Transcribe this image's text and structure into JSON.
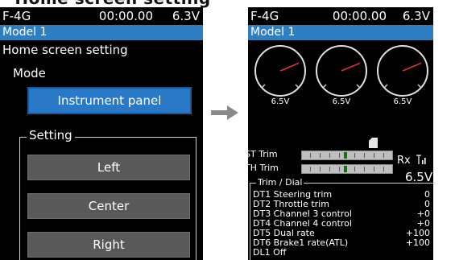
{
  "left_screen": {
    "status": {
      "name": "F-4G",
      "time": "00:00.00",
      "voltage": "6.3V"
    },
    "model": "Model 1",
    "heading": "Home screen setting",
    "mode_label": "Mode",
    "mode_value": "Instrument panel",
    "setting_label": "Setting",
    "buttons": [
      "Left",
      "Center",
      "Right"
    ]
  },
  "right_screen": {
    "status": {
      "name": "F-4G",
      "time": "00:00.00",
      "voltage": "6.3V"
    },
    "model": "Model 1",
    "gauges": [
      {
        "value": "6.5V",
        "needle_level": 0.75
      },
      {
        "value": "6.5V",
        "needle_level": 0.75
      },
      {
        "value": "6.5V",
        "needle_level": 0.75
      }
    ],
    "st_trim": {
      "label": "ST Trim",
      "level": 0.5
    },
    "th_trim": {
      "label": "TH Trim",
      "level": 0.5
    },
    "rx_label": "Rx",
    "rx_voltage": "6.5V",
    "trim_dial_label": "Trim / Dial",
    "rows": [
      {
        "name": "DT1 Steering trim",
        "value": "0"
      },
      {
        "name": "DT2 Throttle trim",
        "value": "0"
      },
      {
        "name": "DT3 Channel 3 control",
        "value": "+0"
      },
      {
        "name": "DT4 Channel 4 control",
        "value": "+0"
      },
      {
        "name": "DT5 Dual rate",
        "value": "+100"
      },
      {
        "name": "DT6 Brake1 rate(ATL)",
        "value": "+100"
      },
      {
        "name": "DL1 Off",
        "value": ""
      }
    ]
  },
  "colors": {
    "accent": "#2e7fc2",
    "button": "#595959",
    "background": "#000000",
    "arrow": "#8a8a8a"
  }
}
